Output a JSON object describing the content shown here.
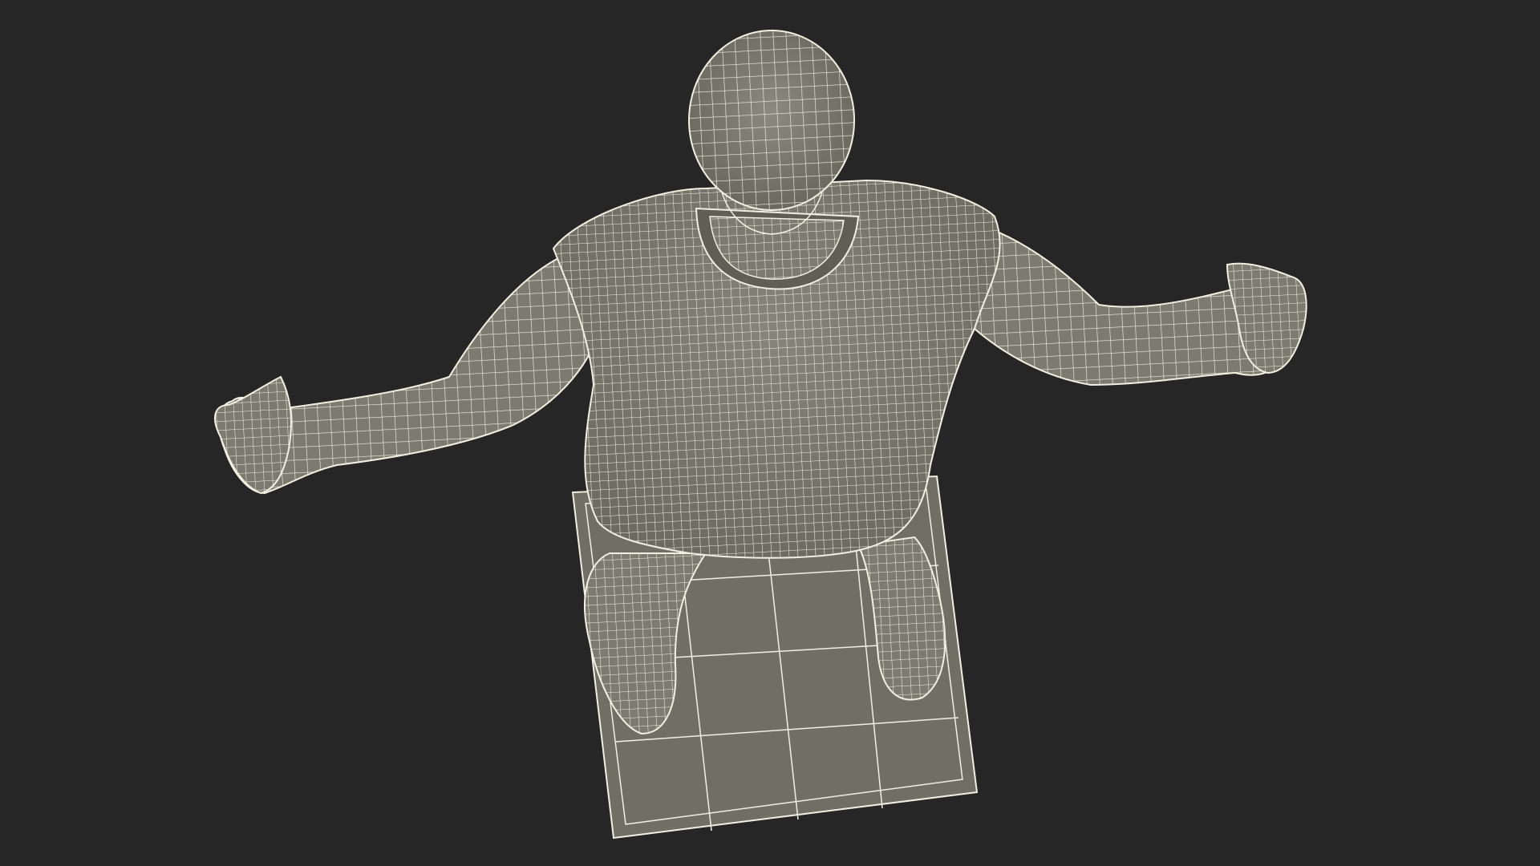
{
  "viewport": {
    "background": "#262626"
  },
  "model": {
    "subject": "human-figure-wireframe",
    "view": "top-down",
    "mesh_fill": "#7b7b70",
    "mesh_fill_dark": "#5f5f56",
    "wire_color": "#f2efe0",
    "base_fill": "#6f6f66"
  }
}
